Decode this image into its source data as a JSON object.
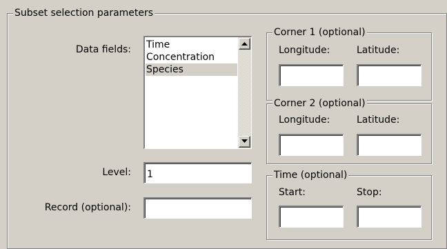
{
  "main_group": {
    "title": "Subset selection parameters"
  },
  "data_fields": {
    "label": "Data fields:",
    "items": [
      {
        "label": "Time",
        "selected": false
      },
      {
        "label": "Concentration",
        "selected": false
      },
      {
        "label": "Species",
        "selected": true
      }
    ],
    "scroll_up_icon": "triangle-up-icon",
    "scroll_down_icon": "triangle-down-icon"
  },
  "level": {
    "label": "Level:",
    "value": "1"
  },
  "record": {
    "label": "Record (optional):",
    "value": ""
  },
  "corner1": {
    "title": "Corner 1 (optional)",
    "longitude_label": "Longitude:",
    "latitude_label": "Latitude:",
    "longitude_value": "",
    "latitude_value": ""
  },
  "corner2": {
    "title": "Corner 2 (optional)",
    "longitude_label": "Longitude:",
    "latitude_label": "Latitude:",
    "longitude_value": "",
    "latitude_value": ""
  },
  "time": {
    "title": "Time (optional)",
    "start_label": "Start:",
    "stop_label": "Stop:",
    "start_value": "",
    "stop_value": ""
  }
}
